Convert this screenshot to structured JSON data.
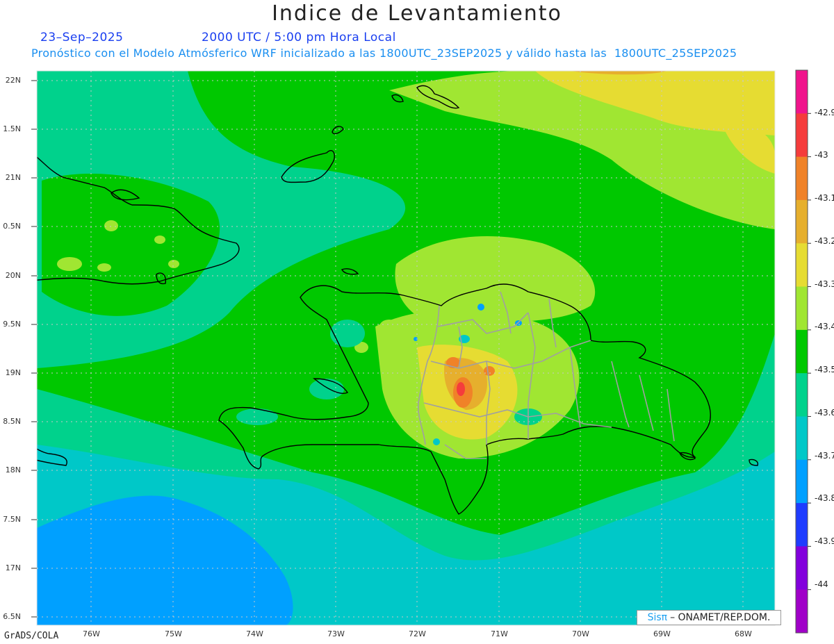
{
  "title": "Indice de Levantamiento",
  "date": "23–Sep–2025",
  "time": "2000 UTC / 5:00 pm Hora Local",
  "subtitle": "Pronóstico con el Modelo Atmósferico WRF inicializado a las 1800UTC_23SEP2025 y válido hasta las  1800UTC_25SEP2025",
  "footer": "GrADS/COLA",
  "credit": {
    "logo": "Sisπ",
    "text": "– ONAMET/REP.DOM."
  },
  "lat_labels": [
    "22N",
    "1.5N",
    "21N",
    "0.5N",
    "20N",
    "9.5N",
    "19N",
    "8.5N",
    "18N",
    "7.5N",
    "17N",
    "6.5N"
  ],
  "lon_labels": [
    "76W",
    "75W",
    "74W",
    "73W",
    "72W",
    "71W",
    "70W",
    "69W",
    "68W"
  ],
  "colorbar": {
    "labels": [
      "-42.9",
      "-43",
      "-43.1",
      "-43.2",
      "-43.3",
      "-43.4",
      "-43.5",
      "-43.6",
      "-43.7",
      "-43.8",
      "-43.9",
      "-44"
    ],
    "colors": [
      "#f0148c",
      "#f53c3c",
      "#f08228",
      "#e6af2d",
      "#e6dc32",
      "#a0e632",
      "#00c800",
      "#00d28c",
      "#00c8c8",
      "#00a0ff",
      "#1e3cff",
      "#8200dc",
      "#a000c8"
    ]
  },
  "palette": {
    "coast": "#000000",
    "borders": "#a0a0a0",
    "grid": "#c8c8c8"
  }
}
